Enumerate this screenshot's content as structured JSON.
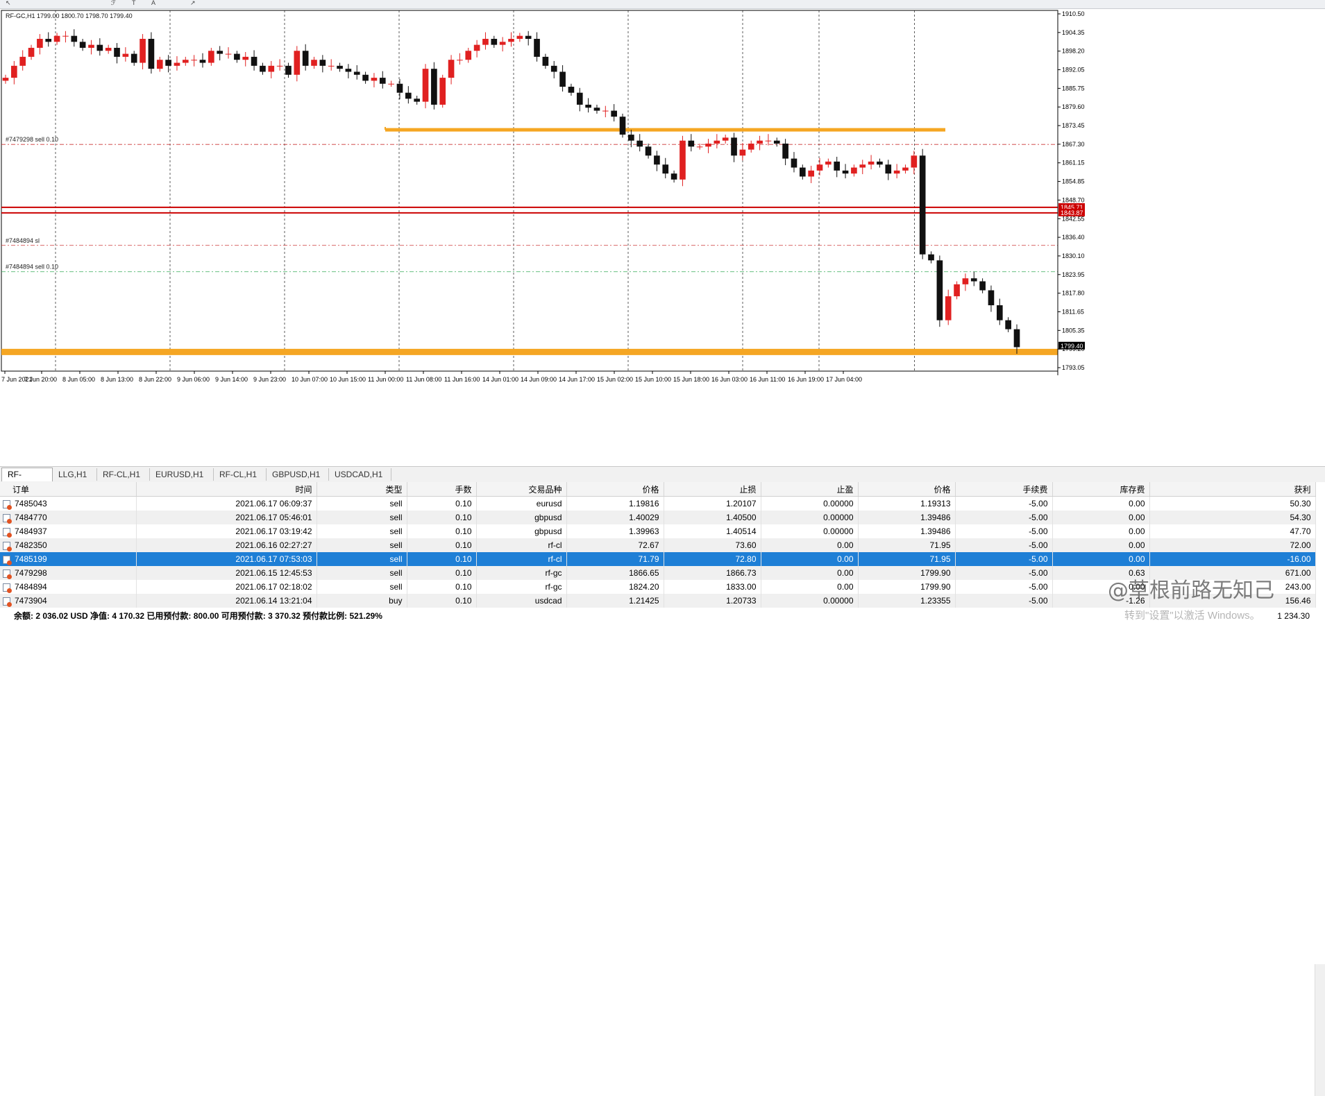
{
  "chart": {
    "header": "RF-GC,H1  1799.00 1800.70 1798.70 1799.40",
    "price_ticks": [
      "1910.50",
      "1904.35",
      "1898.20",
      "1892.05",
      "1885.75",
      "1879.60",
      "1873.45",
      "1867.30",
      "1861.15",
      "1854.85",
      "1848.70",
      "1842.55",
      "1836.40",
      "1830.10",
      "1823.95",
      "1817.80",
      "1811.65",
      "1805.35",
      "1799.20",
      "1793.05"
    ],
    "time_ticks": [
      "7 Jun 2021",
      "7 Jun 20:00",
      "8 Jun 05:00",
      "8 Jun 13:00",
      "8 Jun 22:00",
      "9 Jun 06:00",
      "9 Jun 14:00",
      "9 Jun 23:00",
      "10 Jun 07:00",
      "10 Jun 15:00",
      "11 Jun 00:00",
      "11 Jun 08:00",
      "11 Jun 16:00",
      "14 Jun 01:00",
      "14 Jun 09:00",
      "14 Jun 17:00",
      "15 Jun 02:00",
      "15 Jun 10:00",
      "15 Jun 18:00",
      "16 Jun 03:00",
      "16 Jun 11:00",
      "16 Jun 19:00",
      "17 Jun 04:00"
    ],
    "price_min": 1791.0,
    "price_max": 1911.5,
    "order_labels": [
      {
        "text": "#7479298 sell 0.10",
        "price": 1866.73,
        "color": "#cc3333"
      },
      {
        "text": "#7484894 sl",
        "price": 1833.0,
        "color": "#cc3333"
      },
      {
        "text": "#7484894 sell 0.10",
        "price": 1824.2,
        "color": "#33aa55"
      }
    ],
    "resistance_line": {
      "price": 1871.6
    },
    "support_line": {
      "price": 1797.4
    },
    "red_level_1": {
      "price": 1845.71,
      "label": "1845.71"
    },
    "red_level_2": {
      "price": 1843.87,
      "label": "1843.87"
    },
    "current_price_label": "1799.40",
    "colors": {
      "bull": "#e02020",
      "bear": "#111111",
      "orange": "#f5a623",
      "grid": "#333333"
    },
    "candle_path": [
      1889,
      1893,
      1896,
      1899,
      1902,
      1901,
      1903,
      1903,
      1901,
      1899,
      1900,
      1898,
      1899,
      1896,
      1897,
      1894,
      1902,
      1892,
      1895,
      1893,
      1894,
      1895,
      1895,
      1894,
      1898,
      1897,
      1897,
      1895,
      1896,
      1893,
      1891,
      1893,
      1893,
      1890,
      1898,
      1893,
      1895,
      1893,
      1893,
      1892,
      1891,
      1890,
      1888,
      1889,
      1887,
      1887,
      1884,
      1882,
      1881,
      1892,
      1880,
      1889,
      1895,
      1895,
      1898,
      1900,
      1902,
      1900,
      1901,
      1902,
      1903,
      1902,
      1896,
      1893,
      1891,
      1886,
      1884,
      1880,
      1879,
      1878,
      1878,
      1876,
      1870,
      1868,
      1866,
      1863,
      1860,
      1857,
      1855,
      1868,
      1866,
      1866,
      1867,
      1868,
      1869,
      1863,
      1865,
      1867,
      1868,
      1868,
      1867,
      1862,
      1859,
      1856,
      1858,
      1860,
      1861,
      1858,
      1857,
      1859,
      1860,
      1861,
      1860,
      1857,
      1858,
      1859,
      1863,
      1830,
      1828,
      1808,
      1816,
      1820,
      1822,
      1821,
      1818,
      1813,
      1808,
      1805,
      1799
    ]
  },
  "tabs": [
    "RF-GC,H1",
    "LLG,H1",
    "RF-CL,H1",
    "EURUSD,H1",
    "RF-CL,H1",
    "GBPUSD,H1",
    "USDCAD,H1"
  ],
  "terminal": {
    "columns": [
      "订单",
      "时间",
      "类型",
      "手数",
      "交易品种",
      "价格",
      "止损",
      "止盈",
      "价格",
      "手续费",
      "库存费",
      "获利"
    ],
    "rows": [
      [
        "7485043",
        "2021.06.17 06:09:37",
        "sell",
        "0.10",
        "eurusd",
        "1.19816",
        "1.20107",
        "0.00000",
        "1.19313",
        "-5.00",
        "0.00",
        "50.30"
      ],
      [
        "7484770",
        "2021.06.17 05:46:01",
        "sell",
        "0.10",
        "gbpusd",
        "1.40029",
        "1.40500",
        "0.00000",
        "1.39486",
        "-5.00",
        "0.00",
        "54.30"
      ],
      [
        "7484937",
        "2021.06.17 03:19:42",
        "sell",
        "0.10",
        "gbpusd",
        "1.39963",
        "1.40514",
        "0.00000",
        "1.39486",
        "-5.00",
        "0.00",
        "47.70"
      ],
      [
        "7482350",
        "2021.06.16 02:27:27",
        "sell",
        "0.10",
        "rf-cl",
        "72.67",
        "73.60",
        "0.00",
        "71.95",
        "-5.00",
        "0.00",
        "72.00"
      ],
      [
        "7485199",
        "2021.06.17 07:53:03",
        "sell",
        "0.10",
        "rf-cl",
        "71.79",
        "72.80",
        "0.00",
        "71.95",
        "-5.00",
        "0.00",
        "-16.00"
      ],
      [
        "7479298",
        "2021.06.15 12:45:53",
        "sell",
        "0.10",
        "rf-gc",
        "1866.65",
        "1866.73",
        "0.00",
        "1799.90",
        "-5.00",
        "0.63",
        "671.00"
      ],
      [
        "7484894",
        "2021.06.17 02:18:02",
        "sell",
        "0.10",
        "rf-gc",
        "1824.20",
        "1833.00",
        "0.00",
        "1799.90",
        "-5.00",
        "0.00",
        "243.00"
      ],
      [
        "7473904",
        "2021.06.14 13:21:04",
        "buy",
        "0.10",
        "usdcad",
        "1.21425",
        "1.20733",
        "0.00000",
        "1.23355",
        "-5.00",
        "-1.26",
        "156.46"
      ]
    ],
    "selected_row": 4,
    "summary": "余额: 2 036.02 USD 净值: 4 170.32 已用预付款: 800.00 可用预付款: 3 370.32 预付款比例: 521.29%",
    "summary_profit": "1 234.30"
  },
  "watermark": "@草根前路无知己",
  "windows_activation": "转到\"设置\"以激活 Windows。"
}
